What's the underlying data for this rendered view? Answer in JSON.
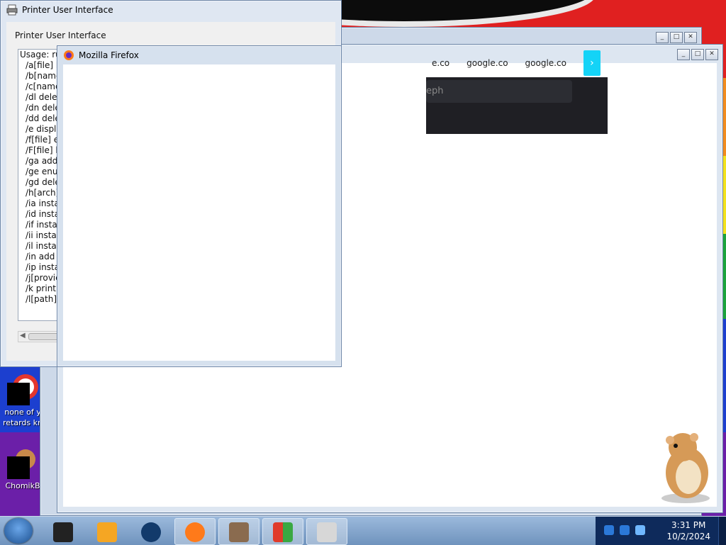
{
  "printer_ui": {
    "title": "Printer User Interface",
    "heading": "Printer User Interface",
    "lines": [
      "Usage: run",
      "/a[file] b",
      "/b[name",
      "/c[name",
      "/dl delet",
      "/dn dele",
      "/dd dele",
      "/e displa",
      "/f[file] e",
      "/F[file] l",
      "/ga add",
      "/ge enu",
      "/gd dele",
      "/h[arch]",
      "/ia insta",
      "/id insta",
      "/if instal",
      "/ii instal",
      "/il instal",
      "/in add",
      "/ip insta",
      "/j[provic",
      "/k print",
      "/l[path]"
    ]
  },
  "firefox_front": {
    "title": "Mozilla Firefox"
  },
  "firefox_back": {
    "tabs": [
      "e.co",
      "google.co",
      "google.co"
    ],
    "next_tab_glyph": "›",
    "search_partial": "eph"
  },
  "desktop": {
    "icons": [
      {
        "label": "none of y retards kn"
      },
      {
        "label": "ChomikB"
      }
    ]
  },
  "taskbar": {
    "items": [
      "app-1",
      "media-player",
      "browser-globe",
      "firefox",
      "app-5",
      "windows-flag",
      "printer"
    ],
    "clock_time": "3:31 PM",
    "clock_date": "10/2/2024"
  },
  "colors": {
    "taskbar": "#7ea2cc",
    "window_frame": "#cfdcee",
    "tab_next": "#14d3f7"
  }
}
